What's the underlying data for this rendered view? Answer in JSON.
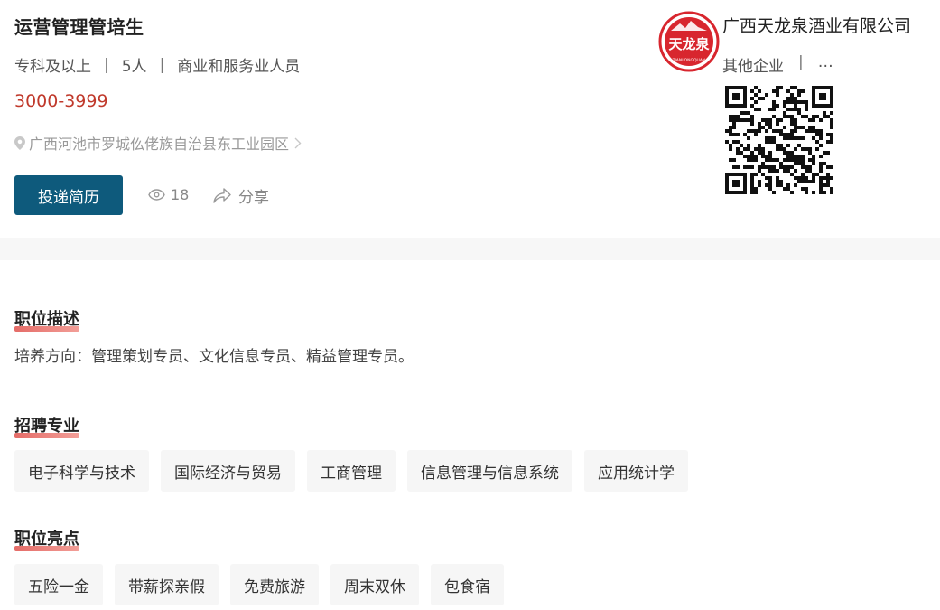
{
  "job": {
    "title": "运营管理管培生",
    "education": "专科及以上",
    "headcount": "5人",
    "category": "商业和服务业人员",
    "salary": "3000-3999",
    "address": "广西河池市罗城仫佬族自治县东工业园区",
    "apply_label": "投递简历",
    "views": "18",
    "share_label": "分享",
    "separator": "|"
  },
  "company": {
    "logo_text": "天龙泉",
    "logo_subtext": "TIANLONGQUAN",
    "name": "广西天龙泉酒业有限公司",
    "type": "其他企业",
    "more": "…",
    "separator": "|"
  },
  "sections": {
    "description": {
      "title": "职位描述",
      "text": "培养方向：管理策划专员、文化信息专员、精益管理专员。"
    },
    "majors": {
      "title": "招聘专业",
      "items": [
        "电子科学与技术",
        "国际经济与贸易",
        "工商管理",
        "信息管理与信息系统",
        "应用统计学"
      ]
    },
    "highlights": {
      "title": "职位亮点",
      "items": [
        "五险一金",
        "带薪探亲假",
        "免费旅游",
        "周末双休",
        "包食宿"
      ]
    }
  },
  "colors": {
    "accent_button": "#0e5a7c",
    "salary": "#c0392b",
    "logo_red": "#d8262e"
  }
}
